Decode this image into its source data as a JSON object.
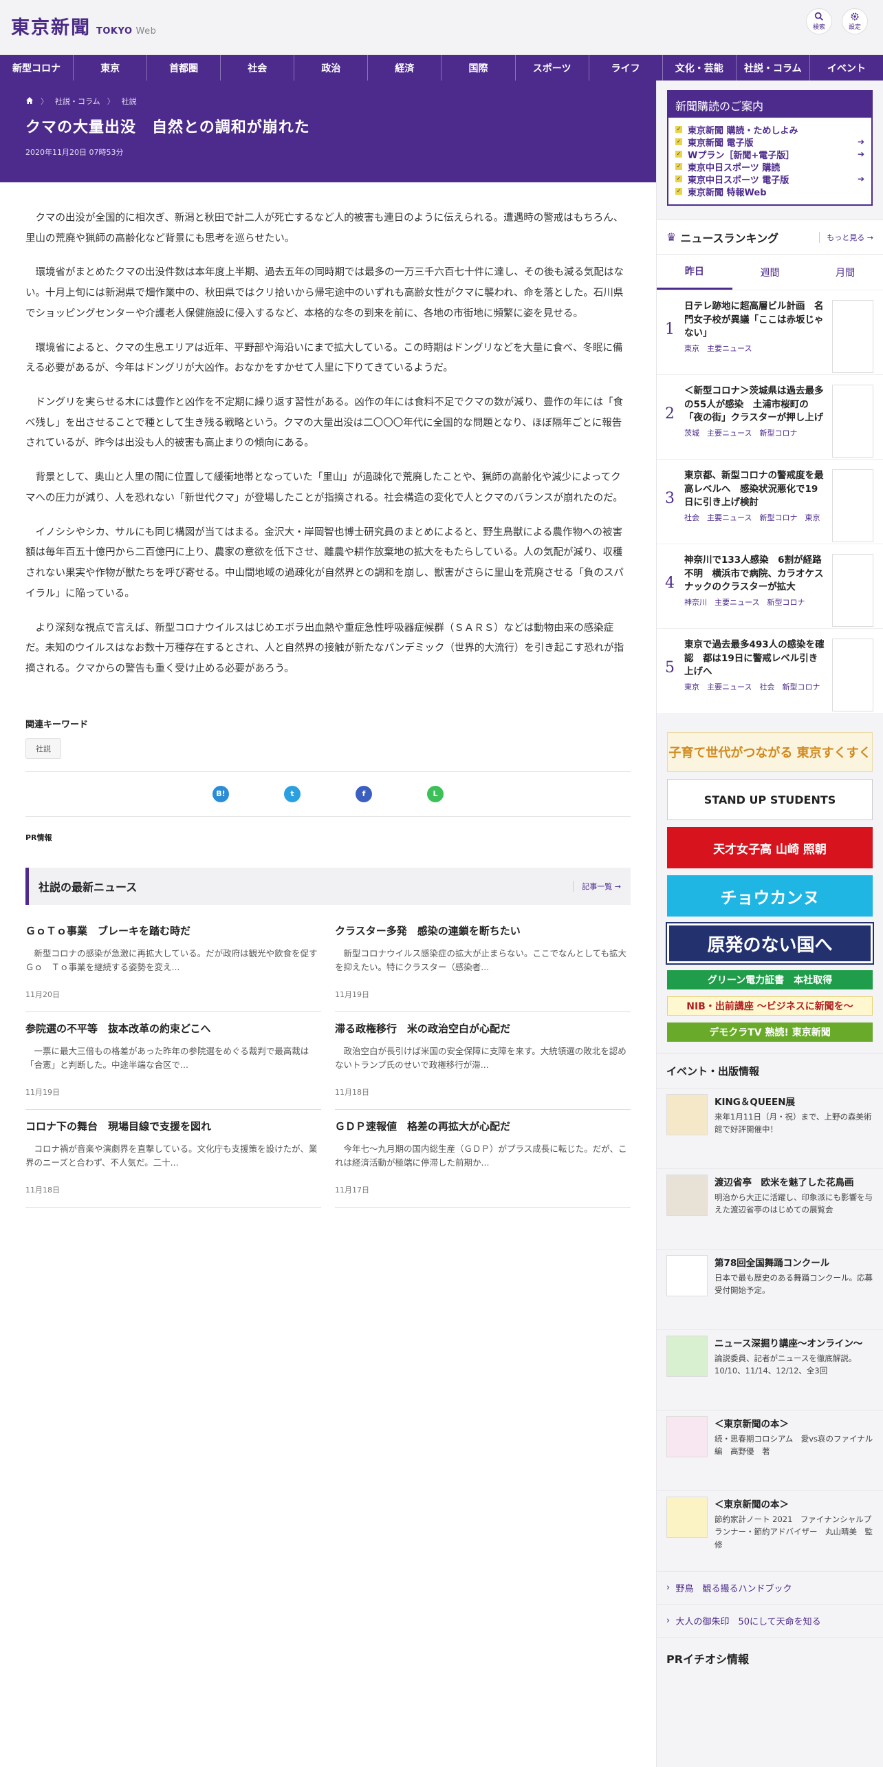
{
  "header": {
    "logo": "東京新聞",
    "logo_sub": "TOKYO",
    "logo_web": "Web",
    "search_label": "検索",
    "settings_label": "設定"
  },
  "nav": [
    "新型コロナ",
    "東京",
    "首都圏",
    "社会",
    "政治",
    "経済",
    "国際",
    "スポーツ",
    "ライフ",
    "文化・芸能",
    "社説・コラム",
    "イベント"
  ],
  "breadcrumb": [
    "社説・コラム",
    "社説"
  ],
  "article": {
    "title": "クマの大量出没　自然との調和が崩れた",
    "date": "2020年11月20日 07時53分",
    "paragraphs": [
      "クマの出没が全国的に相次ぎ、新潟と秋田で計二人が死亡するなど人的被害も連日のように伝えられる。遭遇時の警戒はもちろん、里山の荒廃や猟師の高齢化など背景にも思考を巡らせたい。",
      "環境省がまとめたクマの出没件数は本年度上半期、過去五年の同時期では最多の一万三千六百七十件に達し、その後も減る気配はない。十月上旬には新潟県で畑作業中の、秋田県ではクリ拾いから帰宅途中のいずれも高齢女性がクマに襲われ、命を落とした。石川県でショッピングセンターや介護老人保健施設に侵入するなど、本格的な冬の到来を前に、各地の市街地に頻繁に姿を見せる。",
      "環境省によると、クマの生息エリアは近年、平野部や海沿いにまで拡大している。この時期はドングリなどを大量に食べ、冬眠に備える必要があるが、今年はドングリが大凶作。おなかをすかせて人里に下りてきているようだ。",
      "ドングリを実らせる木には豊作と凶作を不定期に繰り返す習性がある。凶作の年には食料不足でクマの数が減り、豊作の年には「食べ残し」を出させることで種として生き残る戦略という。クマの大量出没は二〇〇〇年代に全国的な問題となり、ほぼ隔年ごとに報告されているが、昨今は出没も人的被害も高止まりの傾向にある。",
      "背景として、奥山と人里の間に位置して緩衝地帯となっていた「里山」が過疎化で荒廃したことや、猟師の高齢化や減少によってクマへの圧力が減り、人を恐れない「新世代クマ」が登場したことが指摘される。社会構造の変化で人とクマのバランスが崩れたのだ。",
      "イノシシやシカ、サルにも同じ構図が当てはまる。金沢大・岸岡智也博士研究員のまとめによると、野生鳥獣による農作物への被害額は毎年百五十億円から二百億円に上り、農家の意欲を低下させ、離農や耕作放棄地の拡大をもたらしている。人の気配が減り、収穫されない果実や作物が獣たちを呼び寄せる。中山間地域の過疎化が自然界との調和を崩し、獣害がさらに里山を荒廃させる「負のスパイラル」に陥っている。",
      "より深刻な視点で言えば、新型コロナウイルスはじめエボラ出血熱や重症急性呼吸器症候群（ＳＡＲＳ）などは動物由来の感染症だ。未知のウイルスはなお数十万種存在するとされ、人と自然界の接触が新たなパンデミック（世界的大流行）を引き起こす恐れが指摘される。クマからの警告も重く受け止める必要があろう。"
    ]
  },
  "keywords": {
    "title": "関連キーワード",
    "tag": "社説"
  },
  "share": {
    "hatena": "B!",
    "twitter": "t",
    "facebook": "f",
    "line": "L"
  },
  "pr_label": "PR情報",
  "latest": {
    "title": "社説の最新ニュース",
    "more": "記事一覧",
    "items": [
      {
        "title": "ＧｏＴｏ事業　ブレーキを踏む時だ",
        "summary": "新型コロナの感染が急激に再拡大している。だが政府は観光や飲食を促すＧｏ　Ｔｏ事業を継続する姿勢を変え...",
        "date": "11月20日"
      },
      {
        "title": "クラスター多発　感染の連鎖を断ちたい",
        "summary": "新型コロナウイルス感染症の拡大が止まらない。ここでなんとしても拡大を抑えたい。特にクラスター（感染者...",
        "date": "11月19日"
      },
      {
        "title": "参院選の不平等　抜本改革の約束どこへ",
        "summary": "一票に最大三倍もの格差があった昨年の参院選をめぐる裁判で最高裁は「合憲」と判断した。中途半端な合区で...",
        "date": "11月19日"
      },
      {
        "title": "滞る政権移行　米の政治空白が心配だ",
        "summary": "政治空白が長引けば米国の安全保障に支障を来す。大統領選の敗北を認めないトランプ氏のせいで政権移行が滞...",
        "date": "11月18日"
      },
      {
        "title": "コロナ下の舞台　現場目線で支援を図れ",
        "summary": "コロナ禍が音楽や演劇界を直撃している。文化庁も支援策を設けたが、業界のニーズと合わず、不人気だ。二十...",
        "date": "11月18日"
      },
      {
        "title": "ＧＤＰ速報値　格差の再拡大が心配だ",
        "summary": "今年七～九月期の国内総生産（ＧＤＰ）がプラス成長に転じた。だが、これは経済活動が極端に停滞した前期か...",
        "date": "11月17日"
      }
    ]
  },
  "subscribe": {
    "title": "新聞購読のご案内",
    "items": [
      "東京新聞 購読・ためしよみ",
      "東京新聞 電子版",
      "Wプラン［新聞+電子版］",
      "東京中日スポーツ 購読",
      "東京中日スポーツ 電子版",
      "東京新聞 特報Web"
    ]
  },
  "ranking": {
    "title": "ニュースランキング",
    "more": "もっと見る",
    "tabs": [
      "昨日",
      "週間",
      "月間"
    ],
    "items": [
      {
        "num": "1",
        "title": "日テレ跡地に超高層ビル計画　名門女子校が異議「ここは赤坂じゃない」",
        "tags": "東京　主要ニュース"
      },
      {
        "num": "2",
        "title": "＜新型コロナ＞茨城県は過去最多の55人が感染　土浦市桜町の「夜の街」クラスターが押し上げ",
        "tags": "茨城　主要ニュース　新型コロナ"
      },
      {
        "num": "3",
        "title": "東京都、新型コロナの警戒度を最高レベルへ　感染状況悪化で19日に引き上げ検討",
        "tags": "社会　主要ニュース　新型コロナ　東京"
      },
      {
        "num": "4",
        "title": "神奈川で133人感染　6割が経路不明　横浜市で病院、カラオケスナックのクラスターが拡大",
        "tags": "神奈川　主要ニュース　新型コロナ"
      },
      {
        "num": "5",
        "title": "東京で過去最多493人の感染を確認　都は19日に警戒レベル引き上げへ",
        "tags": "東京　主要ニュース　社会　新型コロナ"
      }
    ]
  },
  "banners": {
    "sukusuku": "子育て世代がつながる 東京すくすく",
    "students": "STAND UP STUDENTS",
    "yamazaki": "天才女子高 山崎 照朝",
    "choukanu": "チョウカンヌ",
    "genpatsu": "原発のない国へ",
    "green": "グリーン電力証書　本社取得",
    "nib": "NIB・出前講座 ～ビジネスに新聞を～",
    "democra": "デモクラTV 熟読! 東京新聞"
  },
  "events": {
    "title": "イベント・出版情報",
    "items": [
      {
        "title": "KING＆QUEEN展",
        "desc": "来年1月11日（月・祝）まで、上野の森美術館で好評開催中！"
      },
      {
        "title": "渡辺省亭　欧米を魅了した花鳥画",
        "desc": "明治から大正に活躍し、印象派にも影響を与えた渡辺省亭のはじめての展覧会"
      },
      {
        "title": "第78回全国舞踊コンクール",
        "desc": "日本で最も歴史のある舞踊コンクール。応募受付開始予定。"
      },
      {
        "title": "ニュース深掘り講座～オンライン～",
        "desc": "論説委員、記者がニュースを徹底解説。10/10、11/14、12/12、全3回"
      },
      {
        "title": "＜東京新聞の本＞",
        "desc": "続・思春期コロシアム　愛vs哀のファイナル編　高野優　著"
      },
      {
        "title": "＜東京新聞の本＞",
        "desc": "節約家計ノート 2021　ファイナンシャルプランナー・節約アドバイザー　丸山晴美　監修"
      }
    ]
  },
  "links": [
    "野鳥　観る撮るハンドブック",
    "大人の御朱印　50にして天命を知る"
  ],
  "pr_pickup": "PRイチオシ情報"
}
